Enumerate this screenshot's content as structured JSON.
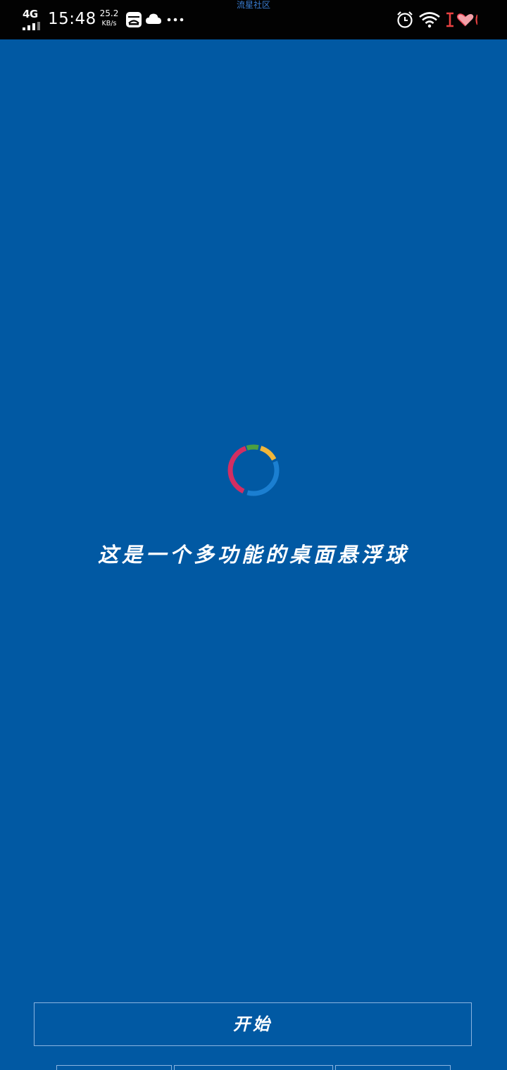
{
  "status_bar": {
    "network_type": "4G",
    "time": "15:48",
    "net_speed_value": "25.2",
    "net_speed_unit": "KB/s",
    "icons": [
      "signal-icon",
      "vivo-app-icon",
      "cloud-icon",
      "more-dots-icon",
      "alarm-icon",
      "wifi-icon",
      "notification-love-icon"
    ]
  },
  "watermark": "流星社区",
  "main": {
    "tagline": "这是一个多功能的桌面悬浮球",
    "loader_colors": [
      "#d32e62",
      "#4ca040",
      "#f0b63b",
      "#1b7fd1"
    ]
  },
  "actions": {
    "start_label": "开始"
  },
  "colors": {
    "background": "#0159a3",
    "status_bar": "#020202",
    "button_border": "#8ab4e0"
  }
}
